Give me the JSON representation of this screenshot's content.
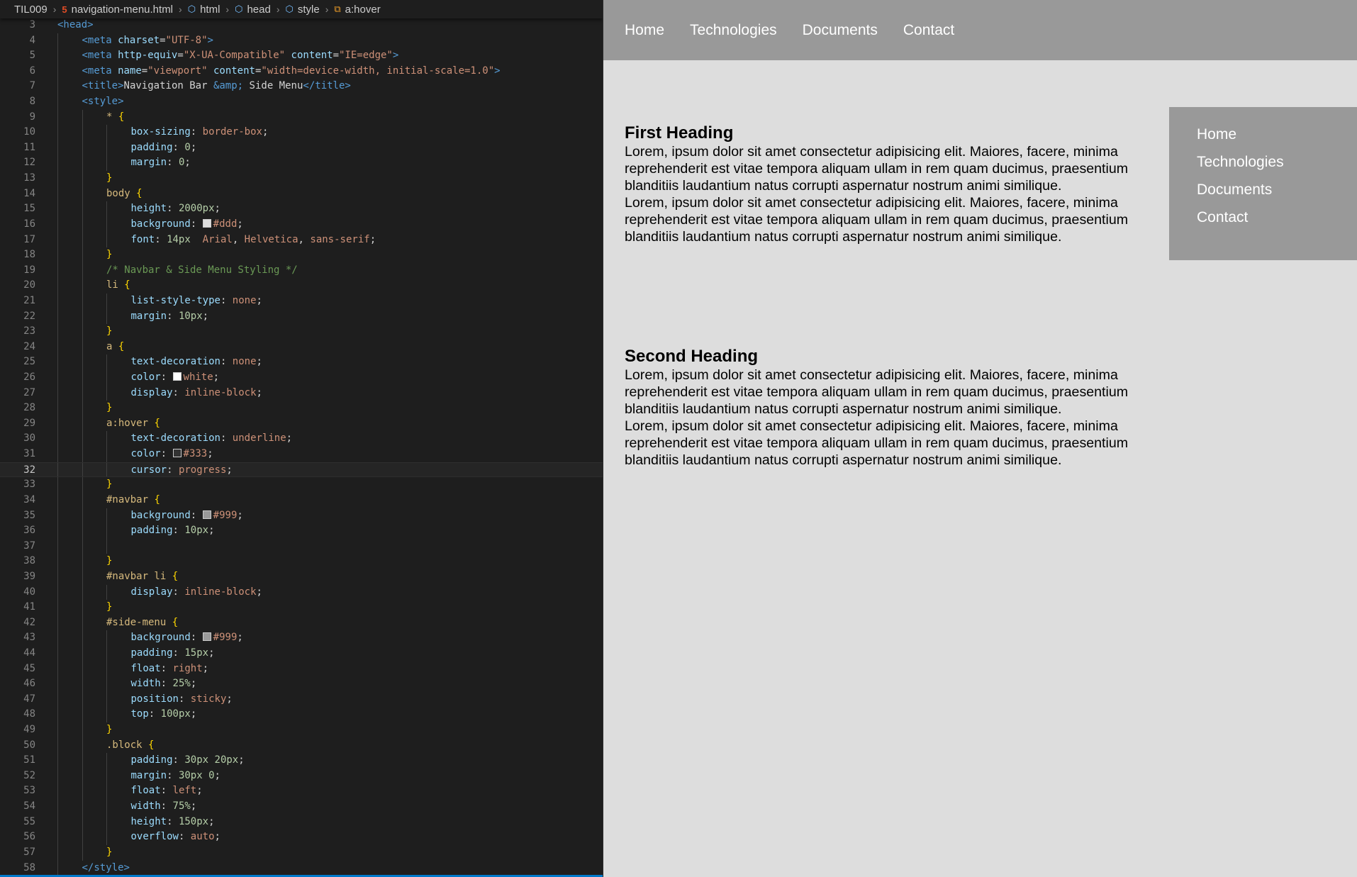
{
  "breadcrumb": {
    "folder": "TIL009",
    "file": "navigation-menu.html",
    "html": "html",
    "head": "head",
    "style": "style",
    "selector": "a:hover"
  },
  "editor": {
    "current_line": 32,
    "lines": [
      {
        "n": "3",
        "indent": 0,
        "tokens": [
          [
            "tag",
            "<head>"
          ]
        ]
      },
      {
        "n": "4",
        "indent": 1,
        "tokens": [
          [
            "tag",
            "<meta "
          ],
          [
            "attr",
            "charset"
          ],
          [
            "punct",
            "="
          ],
          [
            "str",
            "\"UTF-8\""
          ],
          [
            "tag",
            ">"
          ]
        ]
      },
      {
        "n": "5",
        "indent": 1,
        "tokens": [
          [
            "tag",
            "<meta "
          ],
          [
            "attr",
            "http-equiv"
          ],
          [
            "punct",
            "="
          ],
          [
            "str",
            "\"X-UA-Compatible\""
          ],
          [
            "text",
            " "
          ],
          [
            "attr",
            "content"
          ],
          [
            "punct",
            "="
          ],
          [
            "str",
            "\"IE=edge\""
          ],
          [
            "tag",
            ">"
          ]
        ]
      },
      {
        "n": "6",
        "indent": 1,
        "tokens": [
          [
            "tag",
            "<meta "
          ],
          [
            "attr",
            "name"
          ],
          [
            "punct",
            "="
          ],
          [
            "str",
            "\"viewport\""
          ],
          [
            "text",
            " "
          ],
          [
            "attr",
            "content"
          ],
          [
            "punct",
            "="
          ],
          [
            "str",
            "\"width=device-width, initial-scale=1.0\""
          ],
          [
            "tag",
            ">"
          ]
        ]
      },
      {
        "n": "7",
        "indent": 1,
        "tokens": [
          [
            "tag",
            "<title>"
          ],
          [
            "text",
            "Navigation Bar "
          ],
          [
            "ent",
            "&amp;"
          ],
          [
            "text",
            " Side Menu"
          ],
          [
            "tag",
            "</title>"
          ]
        ]
      },
      {
        "n": "8",
        "indent": 1,
        "tokens": [
          [
            "tag",
            "<style>"
          ]
        ]
      },
      {
        "n": "9",
        "indent": 2,
        "tokens": [
          [
            "sel",
            "* "
          ],
          [
            "brace",
            "{"
          ]
        ]
      },
      {
        "n": "10",
        "indent": 3,
        "tokens": [
          [
            "prop",
            "box-sizing"
          ],
          [
            "punct",
            ": "
          ],
          [
            "val",
            "border-box"
          ],
          [
            "punct",
            ";"
          ]
        ]
      },
      {
        "n": "11",
        "indent": 3,
        "tokens": [
          [
            "prop",
            "padding"
          ],
          [
            "punct",
            ": "
          ],
          [
            "num",
            "0"
          ],
          [
            "punct",
            ";"
          ]
        ]
      },
      {
        "n": "12",
        "indent": 3,
        "tokens": [
          [
            "prop",
            "margin"
          ],
          [
            "punct",
            ": "
          ],
          [
            "num",
            "0"
          ],
          [
            "punct",
            ";"
          ]
        ]
      },
      {
        "n": "13",
        "indent": 2,
        "tokens": [
          [
            "brace",
            "}"
          ]
        ]
      },
      {
        "n": "14",
        "indent": 2,
        "tokens": [
          [
            "sel",
            "body "
          ],
          [
            "brace",
            "{"
          ]
        ]
      },
      {
        "n": "15",
        "indent": 3,
        "tokens": [
          [
            "prop",
            "height"
          ],
          [
            "punct",
            ": "
          ],
          [
            "num",
            "2000px"
          ],
          [
            "punct",
            ";"
          ]
        ]
      },
      {
        "n": "16",
        "indent": 3,
        "tokens": [
          [
            "prop",
            "background"
          ],
          [
            "punct",
            ": "
          ],
          [
            "swatch",
            "#dddddd"
          ],
          [
            "val",
            "#ddd"
          ],
          [
            "punct",
            ";"
          ]
        ]
      },
      {
        "n": "17",
        "indent": 3,
        "tokens": [
          [
            "prop",
            "font"
          ],
          [
            "punct",
            ": "
          ],
          [
            "num",
            "14px"
          ],
          [
            "text",
            "  "
          ],
          [
            "val",
            "Arial"
          ],
          [
            "punct",
            ", "
          ],
          [
            "val",
            "Helvetica"
          ],
          [
            "punct",
            ", "
          ],
          [
            "val",
            "sans-serif"
          ],
          [
            "punct",
            ";"
          ]
        ]
      },
      {
        "n": "18",
        "indent": 2,
        "tokens": [
          [
            "brace",
            "}"
          ]
        ]
      },
      {
        "n": "19",
        "indent": 2,
        "tokens": [
          [
            "cmt",
            "/* Navbar & Side Menu Styling */"
          ]
        ]
      },
      {
        "n": "20",
        "indent": 2,
        "tokens": [
          [
            "sel",
            "li "
          ],
          [
            "brace",
            "{"
          ]
        ]
      },
      {
        "n": "21",
        "indent": 3,
        "tokens": [
          [
            "prop",
            "list-style-type"
          ],
          [
            "punct",
            ": "
          ],
          [
            "val",
            "none"
          ],
          [
            "punct",
            ";"
          ]
        ]
      },
      {
        "n": "22",
        "indent": 3,
        "tokens": [
          [
            "prop",
            "margin"
          ],
          [
            "punct",
            ": "
          ],
          [
            "num",
            "10px"
          ],
          [
            "punct",
            ";"
          ]
        ]
      },
      {
        "n": "23",
        "indent": 2,
        "tokens": [
          [
            "brace",
            "}"
          ]
        ]
      },
      {
        "n": "24",
        "indent": 2,
        "tokens": [
          [
            "sel",
            "a "
          ],
          [
            "brace",
            "{"
          ]
        ]
      },
      {
        "n": "25",
        "indent": 3,
        "tokens": [
          [
            "prop",
            "text-decoration"
          ],
          [
            "punct",
            ": "
          ],
          [
            "val",
            "none"
          ],
          [
            "punct",
            ";"
          ]
        ]
      },
      {
        "n": "26",
        "indent": 3,
        "tokens": [
          [
            "prop",
            "color"
          ],
          [
            "punct",
            ": "
          ],
          [
            "swatch",
            "#ffffff"
          ],
          [
            "val",
            "white"
          ],
          [
            "punct",
            ";"
          ]
        ]
      },
      {
        "n": "27",
        "indent": 3,
        "tokens": [
          [
            "prop",
            "display"
          ],
          [
            "punct",
            ": "
          ],
          [
            "val",
            "inline-block"
          ],
          [
            "punct",
            ";"
          ]
        ]
      },
      {
        "n": "28",
        "indent": 2,
        "tokens": [
          [
            "brace",
            "}"
          ]
        ]
      },
      {
        "n": "29",
        "indent": 2,
        "tokens": [
          [
            "sel",
            "a:hover "
          ],
          [
            "brace",
            "{"
          ]
        ]
      },
      {
        "n": "30",
        "indent": 3,
        "tokens": [
          [
            "prop",
            "text-decoration"
          ],
          [
            "punct",
            ": "
          ],
          [
            "val",
            "underline"
          ],
          [
            "punct",
            ";"
          ]
        ]
      },
      {
        "n": "31",
        "indent": 3,
        "tokens": [
          [
            "prop",
            "color"
          ],
          [
            "punct",
            ": "
          ],
          [
            "swatch",
            "#333333"
          ],
          [
            "val",
            "#333"
          ],
          [
            "punct",
            ";"
          ]
        ]
      },
      {
        "n": "32",
        "indent": 3,
        "tokens": [
          [
            "prop",
            "cursor"
          ],
          [
            "punct",
            ": "
          ],
          [
            "val",
            "progress"
          ],
          [
            "punct",
            ";"
          ]
        ]
      },
      {
        "n": "33",
        "indent": 2,
        "tokens": [
          [
            "brace",
            "}"
          ]
        ]
      },
      {
        "n": "34",
        "indent": 2,
        "tokens": [
          [
            "sel",
            "#navbar "
          ],
          [
            "brace",
            "{"
          ]
        ]
      },
      {
        "n": "35",
        "indent": 3,
        "tokens": [
          [
            "prop",
            "background"
          ],
          [
            "punct",
            ": "
          ],
          [
            "swatch",
            "#999999"
          ],
          [
            "val",
            "#999"
          ],
          [
            "punct",
            ";"
          ]
        ]
      },
      {
        "n": "36",
        "indent": 3,
        "tokens": [
          [
            "prop",
            "padding"
          ],
          [
            "punct",
            ": "
          ],
          [
            "num",
            "10px"
          ],
          [
            "punct",
            ";"
          ]
        ]
      },
      {
        "n": "37",
        "indent": 3,
        "tokens": []
      },
      {
        "n": "38",
        "indent": 2,
        "tokens": [
          [
            "brace",
            "}"
          ]
        ]
      },
      {
        "n": "39",
        "indent": 2,
        "tokens": [
          [
            "sel",
            "#navbar li "
          ],
          [
            "brace",
            "{"
          ]
        ]
      },
      {
        "n": "40",
        "indent": 3,
        "tokens": [
          [
            "prop",
            "display"
          ],
          [
            "punct",
            ": "
          ],
          [
            "val",
            "inline-block"
          ],
          [
            "punct",
            ";"
          ]
        ]
      },
      {
        "n": "41",
        "indent": 2,
        "tokens": [
          [
            "brace",
            "}"
          ]
        ]
      },
      {
        "n": "42",
        "indent": 2,
        "tokens": [
          [
            "sel",
            "#side-menu "
          ],
          [
            "brace",
            "{"
          ]
        ]
      },
      {
        "n": "43",
        "indent": 3,
        "tokens": [
          [
            "prop",
            "background"
          ],
          [
            "punct",
            ": "
          ],
          [
            "swatch",
            "#999999"
          ],
          [
            "val",
            "#999"
          ],
          [
            "punct",
            ";"
          ]
        ]
      },
      {
        "n": "44",
        "indent": 3,
        "tokens": [
          [
            "prop",
            "padding"
          ],
          [
            "punct",
            ": "
          ],
          [
            "num",
            "15px"
          ],
          [
            "punct",
            ";"
          ]
        ]
      },
      {
        "n": "45",
        "indent": 3,
        "tokens": [
          [
            "prop",
            "float"
          ],
          [
            "punct",
            ": "
          ],
          [
            "val",
            "right"
          ],
          [
            "punct",
            ";"
          ]
        ]
      },
      {
        "n": "46",
        "indent": 3,
        "tokens": [
          [
            "prop",
            "width"
          ],
          [
            "punct",
            ": "
          ],
          [
            "num",
            "25%"
          ],
          [
            "punct",
            ";"
          ]
        ]
      },
      {
        "n": "47",
        "indent": 3,
        "tokens": [
          [
            "prop",
            "position"
          ],
          [
            "punct",
            ": "
          ],
          [
            "val",
            "sticky"
          ],
          [
            "punct",
            ";"
          ]
        ]
      },
      {
        "n": "48",
        "indent": 3,
        "tokens": [
          [
            "prop",
            "top"
          ],
          [
            "punct",
            ": "
          ],
          [
            "num",
            "100px"
          ],
          [
            "punct",
            ";"
          ]
        ]
      },
      {
        "n": "49",
        "indent": 2,
        "tokens": [
          [
            "brace",
            "}"
          ]
        ]
      },
      {
        "n": "50",
        "indent": 2,
        "tokens": [
          [
            "sel",
            ".block "
          ],
          [
            "brace",
            "{"
          ]
        ]
      },
      {
        "n": "51",
        "indent": 3,
        "tokens": [
          [
            "prop",
            "padding"
          ],
          [
            "punct",
            ": "
          ],
          [
            "num",
            "30px 20px"
          ],
          [
            "punct",
            ";"
          ]
        ]
      },
      {
        "n": "52",
        "indent": 3,
        "tokens": [
          [
            "prop",
            "margin"
          ],
          [
            "punct",
            ": "
          ],
          [
            "num",
            "30px 0"
          ],
          [
            "punct",
            ";"
          ]
        ]
      },
      {
        "n": "53",
        "indent": 3,
        "tokens": [
          [
            "prop",
            "float"
          ],
          [
            "punct",
            ": "
          ],
          [
            "val",
            "left"
          ],
          [
            "punct",
            ";"
          ]
        ]
      },
      {
        "n": "54",
        "indent": 3,
        "tokens": [
          [
            "prop",
            "width"
          ],
          [
            "punct",
            ": "
          ],
          [
            "num",
            "75%"
          ],
          [
            "punct",
            ";"
          ]
        ]
      },
      {
        "n": "55",
        "indent": 3,
        "tokens": [
          [
            "prop",
            "height"
          ],
          [
            "punct",
            ": "
          ],
          [
            "num",
            "150px"
          ],
          [
            "punct",
            ";"
          ]
        ]
      },
      {
        "n": "56",
        "indent": 3,
        "tokens": [
          [
            "prop",
            "overflow"
          ],
          [
            "punct",
            ": "
          ],
          [
            "val",
            "auto"
          ],
          [
            "punct",
            ";"
          ]
        ]
      },
      {
        "n": "57",
        "indent": 2,
        "tokens": [
          [
            "brace",
            "}"
          ]
        ]
      },
      {
        "n": "58",
        "indent": 1,
        "tokens": [
          [
            "tag",
            "</style>"
          ]
        ]
      }
    ]
  },
  "preview": {
    "navbar": [
      "Home",
      "Technologies",
      "Documents",
      "Contact"
    ],
    "side_menu": [
      "Home",
      "Technologies",
      "Documents",
      "Contact"
    ],
    "blocks": [
      {
        "heading": "First Heading",
        "paragraphs": [
          "Lorem, ipsum dolor sit amet consectetur adipisicing elit. Maiores, facere, minima reprehenderit est vitae tempora aliquam ullam in rem quam ducimus, praesentium blanditiis laudantium natus corrupti aspernatur nostrum animi similique.",
          "Lorem, ipsum dolor sit amet consectetur adipisicing elit. Maiores, facere, minima reprehenderit est vitae tempora aliquam ullam in rem quam ducimus, praesentium blanditiis laudantium natus corrupti aspernatur nostrum animi similique."
        ]
      },
      {
        "heading": "Second Heading",
        "paragraphs": [
          "Lorem, ipsum dolor sit amet consectetur adipisicing elit. Maiores, facere, minima reprehenderit est vitae tempora aliquam ullam in rem quam ducimus, praesentium blanditiis laudantium natus corrupti aspernatur nostrum animi similique.",
          "Lorem, ipsum dolor sit amet consectetur adipisicing elit. Maiores, facere, minima reprehenderit est vitae tempora aliquam ullam in rem quam ducimus, praesentium blanditiis laudantium natus corrupti aspernatur nostrum animi similique."
        ]
      }
    ]
  },
  "colors": {
    "editor_bg": "#1e1e1e",
    "preview_bg": "#dddddd",
    "nav_bg": "#999999",
    "link": "#ffffff"
  }
}
